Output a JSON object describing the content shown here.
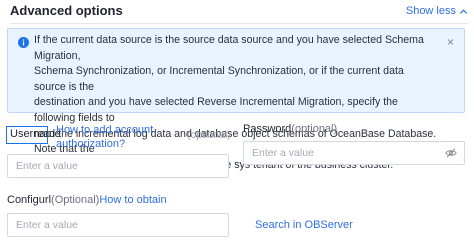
{
  "section": {
    "title": "Advanced options",
    "toggle_label": "Show less"
  },
  "info": {
    "text": "If the current data source is the source data source and you have selected Schema Migration,\nSchema Synchronization, or Incremental Synchronization, or if the current data source is the\ndestination and you have selected Reverse Incremental Migration, specify the following fields to\nread the incremental log data and database object schemas of OceanBase Database. Note that the\nlogged-on user must be created under the sys tenant of the business cluster.",
    "close_glyph": "×"
  },
  "username": {
    "label": "Username",
    "help_link": "How to add account authorization?",
    "optional": "(optional)",
    "placeholder": "Enter a value",
    "value": ""
  },
  "password": {
    "label": "Password",
    "optional": "(optional)",
    "placeholder": "Enter a value",
    "value": ""
  },
  "configurl": {
    "label": "Configurl",
    "optional": "(Optional)",
    "help_link": "How to obtain",
    "placeholder": "Enter a value",
    "value": ""
  },
  "search_link": "Search in OBServer",
  "colors": {
    "accent": "#2f6fe0",
    "info_bg": "#e9f3ff",
    "focus_border": "#1a73e8"
  },
  "icons": {
    "toggle": "chevron-up-icon",
    "info": "info-icon",
    "close": "close-icon",
    "password_visibility": "eye-off-icon"
  }
}
